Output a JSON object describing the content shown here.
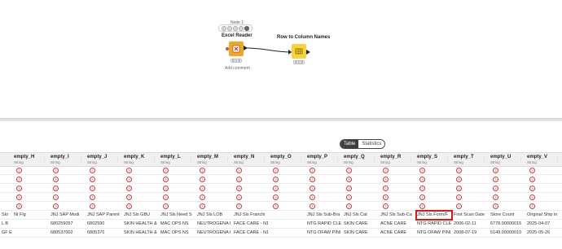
{
  "workflow": {
    "node1": {
      "id_label": "Node 1",
      "title": "Excel Reader",
      "comment": "Add comment"
    },
    "node2": {
      "title": "Row to Column Names"
    }
  },
  "panel": {
    "toggle": {
      "table": "Table",
      "statistics": "Statistics"
    }
  },
  "table": {
    "columns": [
      {
        "name": "empty_H",
        "type": "String"
      },
      {
        "name": "empty_I",
        "type": "String"
      },
      {
        "name": "empty_J",
        "type": "String"
      },
      {
        "name": "empty_K",
        "type": "String"
      },
      {
        "name": "empty_L",
        "type": "String"
      },
      {
        "name": "empty_M",
        "type": "String"
      },
      {
        "name": "empty_N",
        "type": "String"
      },
      {
        "name": "empty_O",
        "type": "String"
      },
      {
        "name": "empty_P",
        "type": "String"
      },
      {
        "name": "empty_Q",
        "type": "String"
      },
      {
        "name": "empty_R",
        "type": "String"
      },
      {
        "name": "empty_S",
        "type": "String"
      },
      {
        "name": "empty_T",
        "type": "String"
      },
      {
        "name": "empty_U",
        "type": "String"
      },
      {
        "name": "empty_V",
        "type": "String"
      }
    ],
    "data_rows": [
      [
        "Slo",
        "NI Flg",
        "JNJ SAP Modi",
        "JNJ SAP Parent",
        "JNJ Sls GBU",
        "JNJ Sls Need S",
        "JNJ Sls LOB",
        "JNJ Sls Franchi",
        "",
        "JNJ Sls Sub-Bra",
        "JNJ Sls Cat",
        "JNJ Sls Sub-Ca",
        "JNJ Sls Form/F",
        "First Scan Date",
        "Store Count",
        "Original Ship in"
      ],
      [
        "L B",
        "",
        "680259057",
        "6802590",
        "SKIN HEALTH &",
        "MAC OPS NS",
        "NEUTROGENA I",
        "FACE CARE - N1",
        "",
        "NTG RAPID CLE",
        "SKIN CARE",
        "ACNE CARE",
        "NTG RAPID CLE",
        "2006-02-11",
        "6778.00000015",
        "2025-04-07"
      ],
      [
        "GF E",
        "",
        "680537002",
        "6805370",
        "SKIN HEALTH &",
        "MAC OPS NS",
        "NEUTROGENA I",
        "FACE CARE - N1",
        "",
        "NTG OFAW PINI",
        "SKIN CARE",
        "ACNE CARE",
        "NTG OFAW PINI",
        "2008-07-19",
        "5149.00000010",
        "2025-05-26"
      ]
    ]
  }
}
